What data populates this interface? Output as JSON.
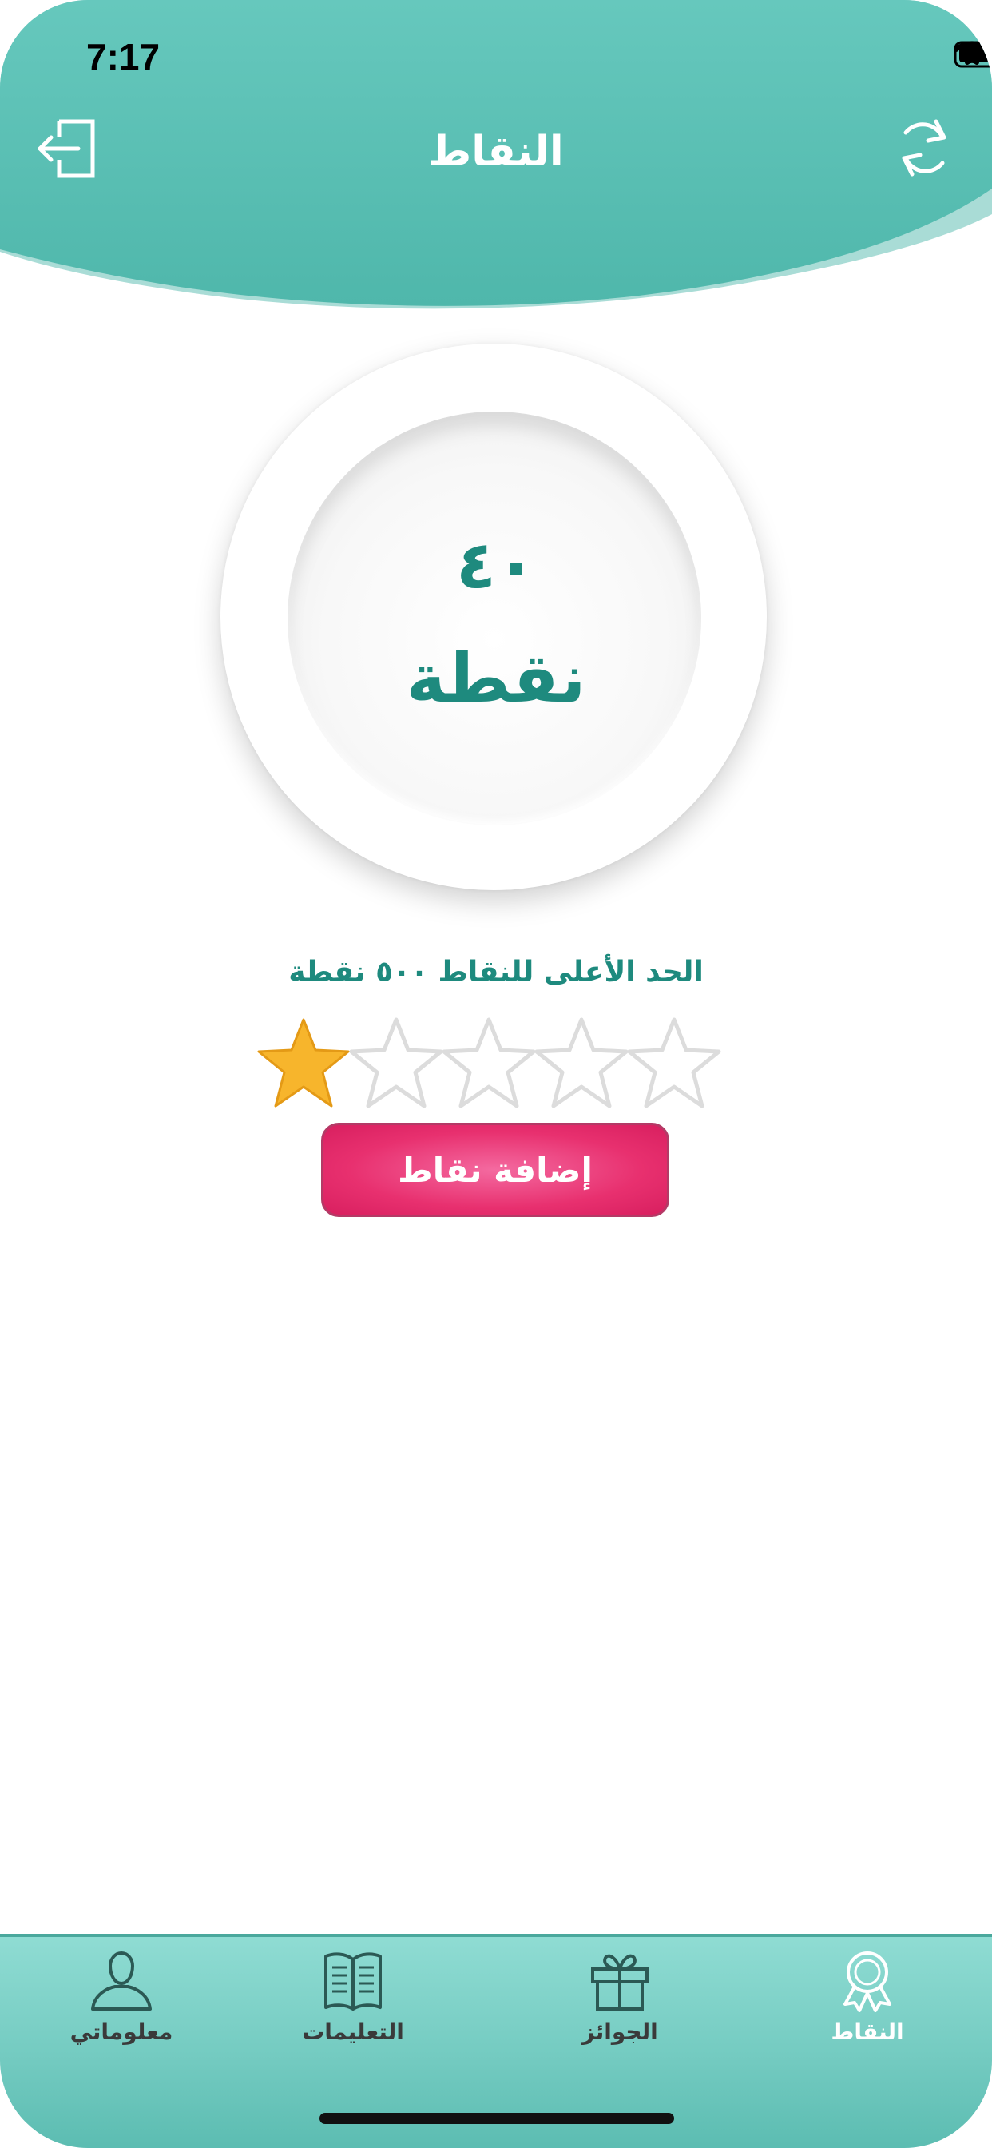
{
  "status_bar": {
    "time": "7:17"
  },
  "header": {
    "title": "النقاط",
    "logout_icon": "logout-icon",
    "refresh_icon": "refresh-icon"
  },
  "points": {
    "value": "٤٠",
    "unit": "نقطة",
    "max_text": "الحد الأعلى للنقاط ٥٠٠ نقطة",
    "rating": 1,
    "rating_max": 5
  },
  "actions": {
    "add_points_label": "إضافة نقاط"
  },
  "tabs": [
    {
      "label": "معلوماتي",
      "icon": "user-icon",
      "active": false
    },
    {
      "label": "التعليمات",
      "icon": "book-icon",
      "active": false
    },
    {
      "label": "الجوائز",
      "icon": "gift-icon",
      "active": false
    },
    {
      "label": "النقاط",
      "icon": "badge-icon",
      "active": true
    }
  ],
  "colors": {
    "primary": "#5bbfb4",
    "accent_text": "#1e8a7e",
    "button": "#e8306f",
    "star_filled": "#f7b52c"
  }
}
